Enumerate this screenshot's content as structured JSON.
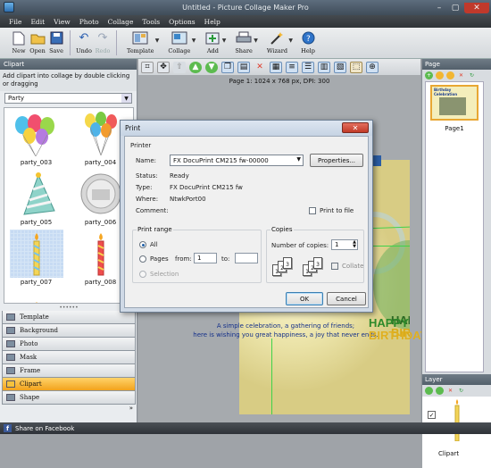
{
  "window": {
    "title": "Untitled - Picture Collage Maker Pro"
  },
  "menu": [
    "File",
    "Edit",
    "View",
    "Photo",
    "Collage",
    "Tools",
    "Options",
    "Help"
  ],
  "toolbar": {
    "new": "New",
    "open": "Open",
    "save": "Save",
    "undo": "Undo",
    "redo": "Redo",
    "template": "Template",
    "collage": "Collage",
    "add": "Add",
    "share": "Share",
    "wizard": "Wizard",
    "help": "Help"
  },
  "clipart_panel": {
    "header": "Clipart",
    "description": "Add clipart into collage by double clicking or dragging",
    "category": "Party",
    "items": [
      "party_003",
      "party_004",
      "party_005",
      "party_006",
      "party_007",
      "party_008"
    ]
  },
  "nav": [
    "Template",
    "Background",
    "Photo",
    "Mask",
    "Frame",
    "Clipart",
    "Shape"
  ],
  "nav_more": "»",
  "canvas": {
    "page_info": "Page 1: 1024 x 768 px, DPI: 300",
    "wish_line1": "A simple celebration, a gathering of friends;",
    "wish_line2": "here is wishing you great happiness, a joy that never ends.",
    "happy": "HAPPY",
    "birthday": "BIRTHDAY"
  },
  "page_panel": {
    "header": "Page",
    "thumb_label": "Page1",
    "thumb_title": "Birthday Celebration"
  },
  "layer_panel": {
    "header": "Layer",
    "item_label": "Clipart"
  },
  "status": {
    "share": "Share on Facebook"
  },
  "dialog": {
    "title": "Print",
    "close": "✕",
    "printer_group": "Printer",
    "name_label": "Name:",
    "printer_name": "FX DocuPrint CM215 fw-00000",
    "properties": "Properties...",
    "status_label": "Status:",
    "status_value": "Ready",
    "type_label": "Type:",
    "type_value": "FX DocuPrint CM215 fw",
    "where_label": "Where:",
    "where_value": "NtwkPort00",
    "comment_label": "Comment:",
    "print_to_file": "Print to file",
    "range_group": "Print range",
    "all": "All",
    "pages": "Pages",
    "from": "from:",
    "from_value": "1",
    "to": "to:",
    "to_value": "",
    "selection": "Selection",
    "copies_group": "Copies",
    "copies_label": "Number of copies:",
    "copies_value": "1",
    "collate": "Collate",
    "ok": "OK",
    "cancel": "Cancel"
  }
}
